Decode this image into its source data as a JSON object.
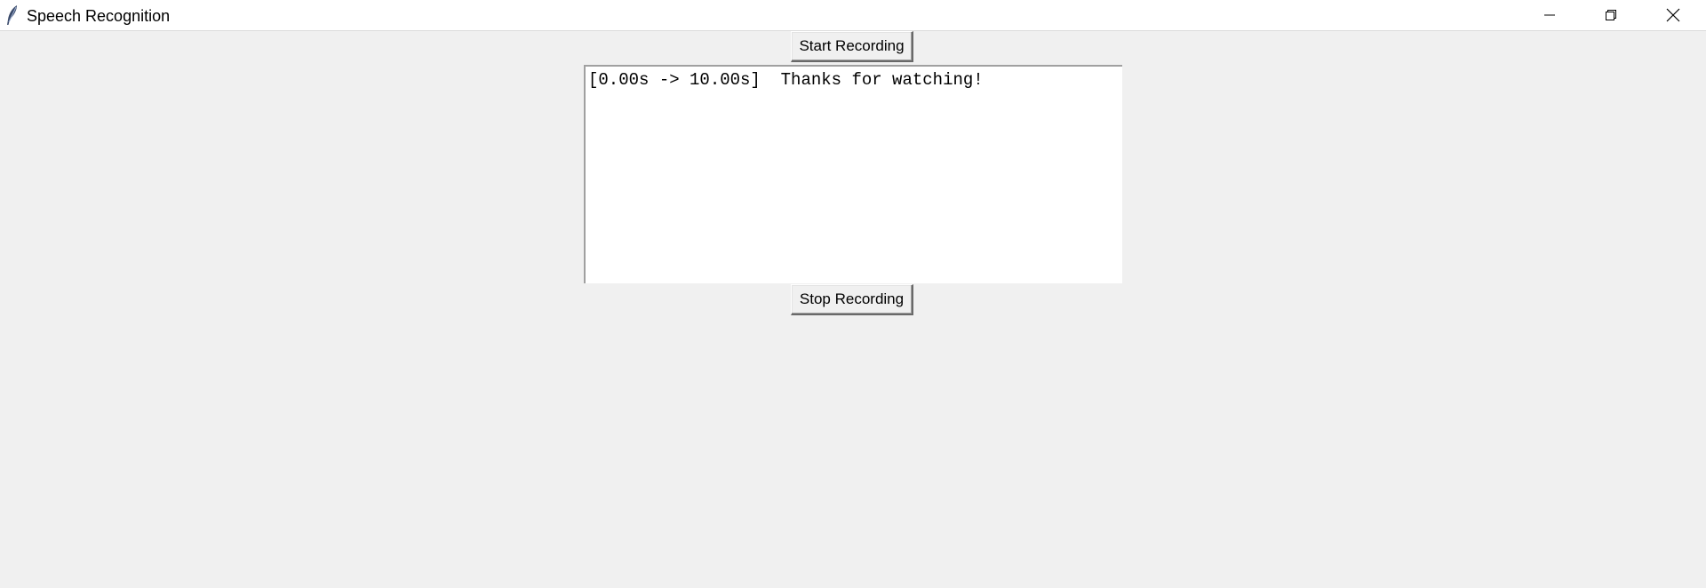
{
  "window": {
    "title": "Speech Recognition",
    "icon": "feather-icon",
    "controls": [
      "minimize-icon",
      "restore-icon",
      "close-icon"
    ]
  },
  "toolbar": {
    "start_label": "Start Recording",
    "stop_label": "Stop Recording"
  },
  "transcript": {
    "lines": [
      "[0.00s -> 10.00s]  Thanks for watching!"
    ]
  },
  "colors": {
    "background": "#f0f0f0",
    "titlebar": "#ffffff",
    "textbox": "#ffffff",
    "text": "#000000"
  }
}
